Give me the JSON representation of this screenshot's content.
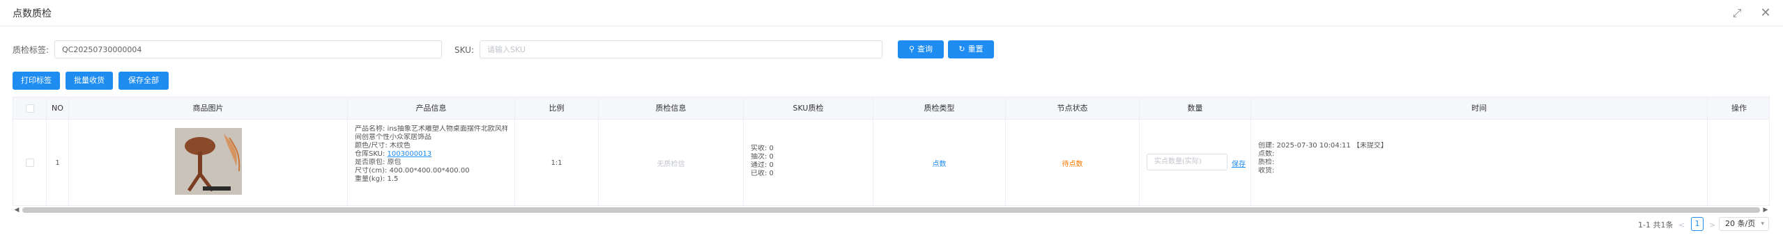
{
  "window": {
    "title": "点数质检",
    "maximize_icon": "expand-icon",
    "close_icon": "close-icon"
  },
  "filters": {
    "tag_label": "质检标签:",
    "tag_value": "QC20250730000004",
    "sku_label": "SKU:",
    "sku_placeholder": "请输入SKU",
    "search_button": "查询",
    "reset_button": "重置"
  },
  "actions": {
    "print_label": "打印标签",
    "batch_receive": "批量收货",
    "save_all": "保存全部"
  },
  "table": {
    "headers": [
      "NO",
      "商品图片",
      "产品信息",
      "比例",
      "质检信息",
      "SKU质检",
      "质检类型",
      "节点状态",
      "数量",
      "时间",
      "操作"
    ],
    "rows": [
      {
        "no": "1",
        "product_info": [
          "产品名称: ins抽象艺术雕塑人物桌面摆件北欧风样板",
          "间创意个性小众家居饰品",
          "颜色/尺寸: 木纹色",
          "仓库SKU: ",
          "尺寸(cm): 400.00*400.00*400.00",
          "重量(kg): 1.5"
        ],
        "warehouse_sku": "1003000013",
        "origin_label": "是否原包:",
        "origin_value": "原包",
        "ratio": "1:1",
        "qc_info": "无质检信",
        "sku_qc": [
          "实收: 0",
          "抽次: 0",
          "通过: 0",
          "已收: 0"
        ],
        "qc_type": "点数",
        "node_status": "待点数",
        "qty_placeholder": "实点数量(实际)",
        "qty_action": "保存",
        "time": [
          "创建: 2025-07-30 10:04:11 【未提交】",
          "点数:",
          "质检:",
          "收货:"
        ]
      }
    ]
  },
  "pagination": {
    "summary": "1-1 共1条",
    "prev": "<",
    "page": "1",
    "next": ">",
    "page_size": "20 条/页"
  },
  "colors": {
    "primary": "#1e8cf0",
    "status_pending": "#ff7a00"
  }
}
